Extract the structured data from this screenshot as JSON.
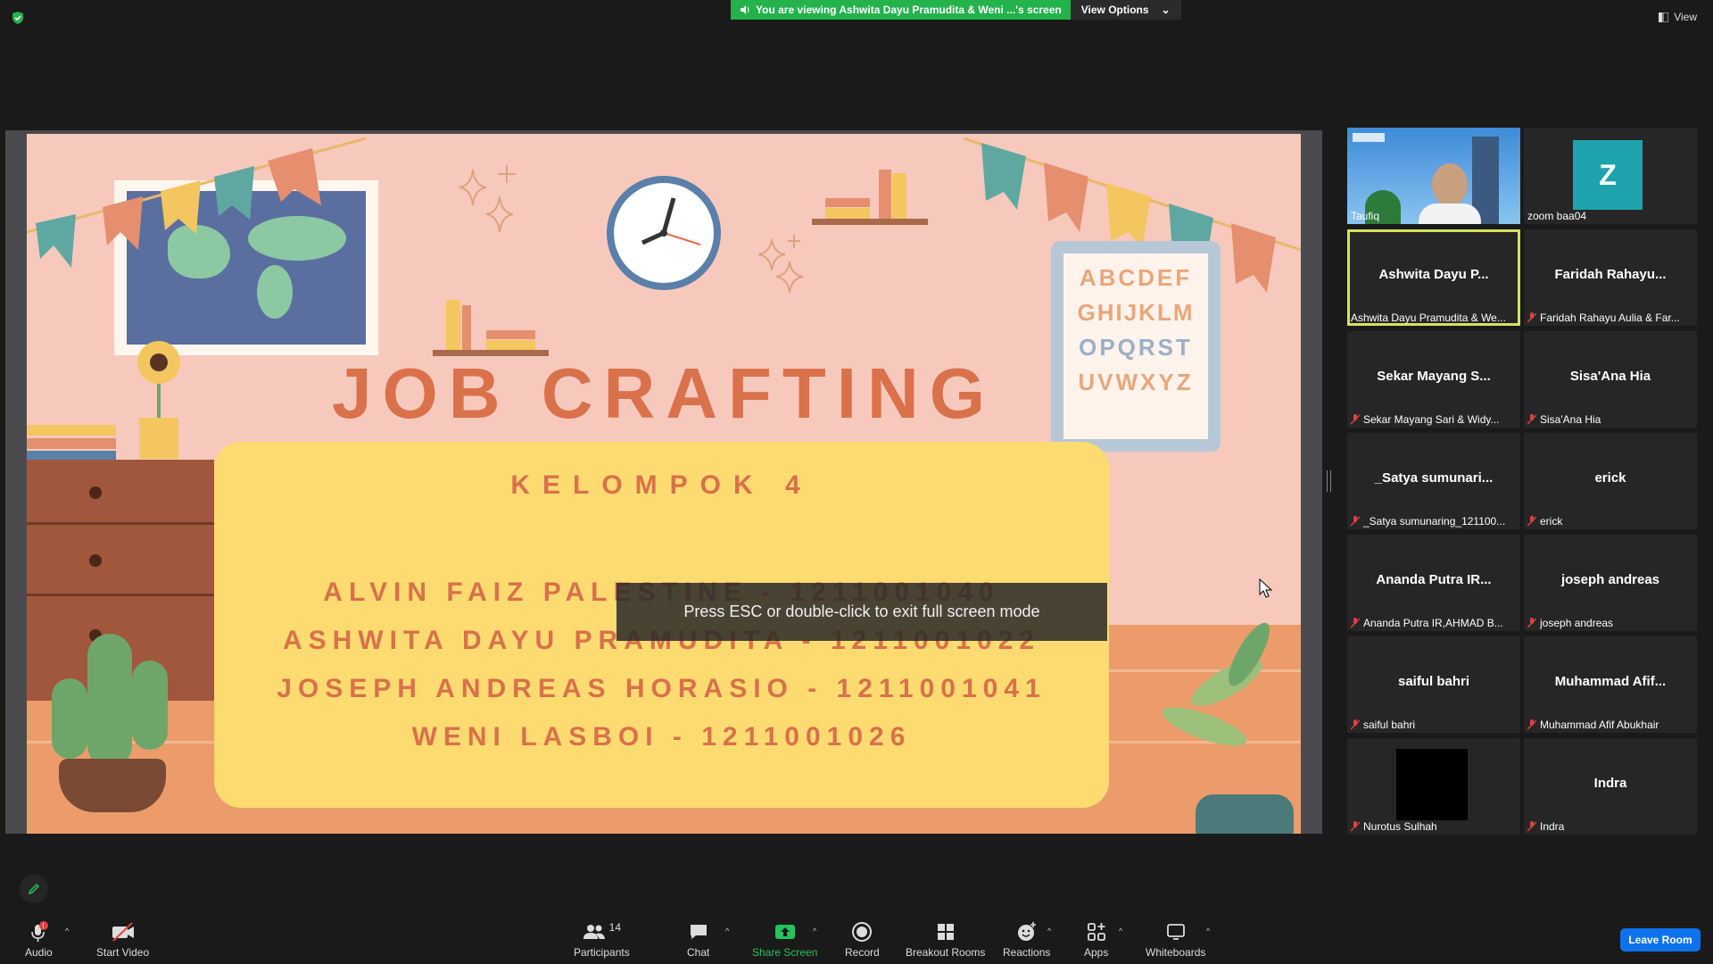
{
  "banner": {
    "viewing": "You are viewing Ashwita Dayu Pramudita & Weni ...'s screen",
    "options": "View Options"
  },
  "view_label": "View",
  "slide": {
    "title": "JOB CRAFTING",
    "subtitle": "KELOMPOK 4",
    "alphabet": [
      "ABCDEF",
      "GHIJKLM",
      "OPQRST",
      "UVWXYZ"
    ],
    "members": [
      "ALVIN FAIZ PALESTINE - 1211001040",
      "ASHWITA DAYU PRAMUDITA - 1211001022",
      "JOSEPH ANDREAS HORASIO - 1211001041",
      "WENI LASBOI - 1211001026"
    ]
  },
  "toast": "Press ESC or double-click to exit full screen mode",
  "participants_panel": [
    {
      "name": "",
      "label": "Taufiq",
      "type": "video"
    },
    {
      "name": "",
      "label": "zoom baa04",
      "type": "avatar",
      "initial": "Z"
    },
    {
      "name": "Ashwita Dayu P...",
      "label": "Ashwita Dayu Pramudita & We...",
      "type": "name",
      "active": true
    },
    {
      "name": "Faridah Rahayu...",
      "label": "Faridah Rahayu Aulia & Far...",
      "type": "name",
      "muted": true
    },
    {
      "name": "Sekar Mayang S...",
      "label": "Sekar Mayang Sari & Widy...",
      "type": "name",
      "muted": true
    },
    {
      "name": "Sisa'Ana Hia",
      "label": "Sisa'Ana Hia",
      "type": "name",
      "muted": true
    },
    {
      "name": "_Satya sumunari...",
      "label": "_Satya sumunaring_121100...",
      "type": "name",
      "muted": true
    },
    {
      "name": "erick",
      "label": "erick",
      "type": "name",
      "muted": true
    },
    {
      "name": "Ananda Putra IR...",
      "label": "Ananda Putra IR,AHMAD B...",
      "type": "name",
      "muted": true
    },
    {
      "name": "joseph andreas",
      "label": "joseph andreas",
      "type": "name",
      "muted": true
    },
    {
      "name": "saiful bahri",
      "label": "saiful bahri",
      "type": "name",
      "muted": true
    },
    {
      "name": "Muhammad Afif...",
      "label": "Muhammad Afif Abukhair",
      "type": "name",
      "muted": true
    },
    {
      "name": "",
      "label": "Nurotus Sulhah",
      "type": "black",
      "muted": true
    },
    {
      "name": "Indra",
      "label": "Indra",
      "type": "name",
      "muted": true
    }
  ],
  "toolbar": {
    "audio": "Audio",
    "video": "Start Video",
    "participants": "Participants",
    "participants_count": "14",
    "chat": "Chat",
    "share": "Share Screen",
    "record": "Record",
    "breakout": "Breakout Rooms",
    "reactions": "Reactions",
    "apps": "Apps",
    "whiteboards": "Whiteboards",
    "leave": "Leave Room"
  },
  "colors": {
    "share_green": "#23b24b",
    "leave_blue": "#0e72ed",
    "active_speaker": "#d4e35a",
    "slide_text": "#d9714a"
  }
}
